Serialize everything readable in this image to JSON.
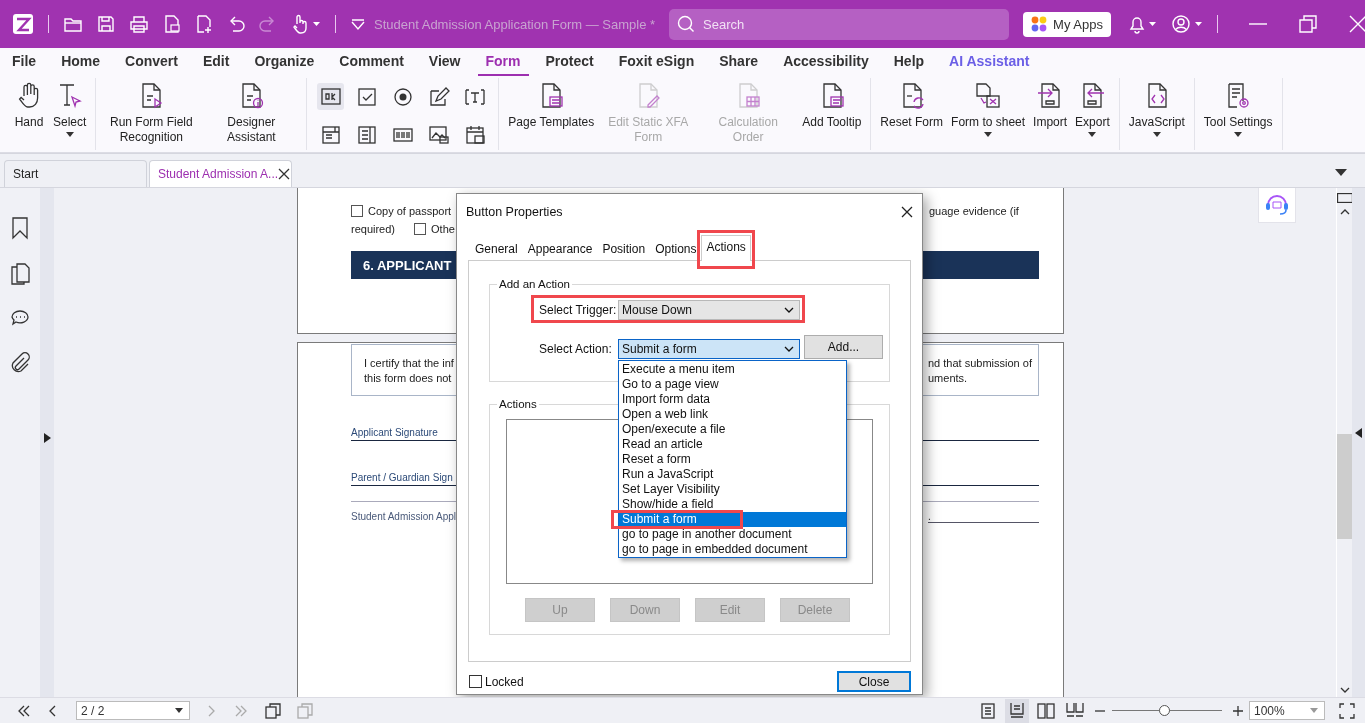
{
  "title_bar": {
    "title": "Student Admission Application Form — Sample *",
    "search": {
      "placeholder": "Search"
    },
    "my_apps": "My Apps"
  },
  "menu": [
    {
      "label": "File",
      "selected": false,
      "kind": "tab"
    },
    {
      "label": "Home",
      "selected": false,
      "kind": "tab"
    },
    {
      "label": "Convert",
      "selected": false,
      "kind": "tab"
    },
    {
      "label": "Edit",
      "selected": false,
      "kind": "tab"
    },
    {
      "label": "Organize",
      "selected": false,
      "kind": "tab"
    },
    {
      "label": "Comment",
      "selected": false,
      "kind": "tab"
    },
    {
      "label": "View",
      "selected": false,
      "kind": "tab"
    },
    {
      "label": "Form",
      "selected": true,
      "kind": "tab"
    },
    {
      "label": "Protect",
      "selected": false,
      "kind": "tab"
    },
    {
      "label": "Foxit eSign",
      "selected": false,
      "kind": "tab"
    },
    {
      "label": "Share",
      "selected": false,
      "kind": "tab"
    },
    {
      "label": "Accessibility",
      "selected": false,
      "kind": "tab"
    },
    {
      "label": "Help",
      "selected": false,
      "kind": "tab"
    },
    {
      "label": "AI Assistant",
      "selected": false,
      "kind": "assistant"
    }
  ],
  "ribbon": {
    "groups": [
      {
        "kind": "tools",
        "tools": [
          {
            "label": "Hand",
            "disabled": false,
            "dropdown": false
          },
          {
            "label": "Select",
            "disabled": false,
            "dropdown": true
          }
        ]
      },
      {
        "kind": "tools",
        "tools": [
          {
            "label": "Run Form Field Recognition",
            "disabled": false,
            "dropdown": false
          },
          {
            "label": "Designer Assistant",
            "disabled": false,
            "dropdown": false
          }
        ]
      },
      {
        "kind": "grid",
        "buttons": [
          {
            "selected": true
          },
          {
            "selected": false
          },
          {
            "selected": false
          },
          {
            "selected": false
          },
          {
            "selected": false
          },
          {
            "selected": false
          },
          {
            "selected": false
          },
          {
            "selected": false
          },
          {
            "selected": false
          },
          {
            "selected": false
          }
        ]
      },
      {
        "kind": "tools",
        "tools": [
          {
            "label": "Page Templates",
            "disabled": false,
            "dropdown": false
          },
          {
            "label": "Edit Static XFA Form",
            "disabled": true,
            "dropdown": false
          },
          {
            "label": "Calculation Order",
            "disabled": true,
            "dropdown": false
          },
          {
            "label": "Add Tooltip",
            "disabled": false,
            "dropdown": false
          }
        ]
      },
      {
        "kind": "tools",
        "tools": [
          {
            "label": "Reset Form",
            "disabled": false,
            "dropdown": false
          },
          {
            "label": "Form to sheet",
            "disabled": false,
            "dropdown": true
          },
          {
            "label": "Import",
            "disabled": false,
            "dropdown": false
          },
          {
            "label": "Export",
            "disabled": false,
            "dropdown": true
          }
        ]
      },
      {
        "kind": "tools",
        "tools": [
          {
            "label": "JavaScript",
            "disabled": false,
            "dropdown": true
          }
        ]
      },
      {
        "kind": "tools",
        "tools": [
          {
            "label": "Tool Settings",
            "disabled": false,
            "dropdown": true
          }
        ]
      }
    ]
  },
  "doc_tabs": [
    {
      "label": "Start",
      "selected": false,
      "closable": false
    },
    {
      "label": "Student Admission A...",
      "selected": true,
      "closable": true
    }
  ],
  "page_1": {
    "checkbox_line": {
      "checked": false,
      "left": "Copy of passport",
      "right": "guage evidence (if"
    },
    "second_line": {
      "before": "required)",
      "checked": false,
      "after": "Othe"
    },
    "section_banner": "6. APPLICANT"
  },
  "page_2": {
    "statement": {
      "left_lines": [
        "I certify that the inf",
        "this form does not"
      ],
      "right_lines": [
        "nd that submission of",
        "uments."
      ]
    },
    "signature_lines": [
      "Applicant Signature",
      "Parent / Guardian Sign"
    ],
    "footer": {
      "left": "Student Admission Appl",
      "right": "."
    }
  },
  "dialog": {
    "title": "Button Properties",
    "tabs": [
      {
        "label": "General",
        "selected": false,
        "highlighted": false
      },
      {
        "label": "Appearance",
        "selected": false,
        "highlighted": false
      },
      {
        "label": "Position",
        "selected": false,
        "highlighted": false
      },
      {
        "label": "Options",
        "selected": false,
        "highlighted": false
      },
      {
        "label": "Actions",
        "selected": true,
        "highlighted": true
      }
    ],
    "add_group": {
      "title": "Add an Action",
      "trigger": {
        "label": "Select Trigger:",
        "value": "Mouse Down",
        "highlighted": true
      },
      "action": {
        "label": "Select Action:",
        "value": "Submit a form",
        "expanded": true,
        "options": [
          {
            "label": "Execute a menu item",
            "selected": false,
            "highlighted": false
          },
          {
            "label": "Go to a page view",
            "selected": false,
            "highlighted": false
          },
          {
            "label": "Import form data",
            "selected": false,
            "highlighted": false
          },
          {
            "label": "Open a web link",
            "selected": false,
            "highlighted": false
          },
          {
            "label": "Open/execute a file",
            "selected": false,
            "highlighted": false
          },
          {
            "label": "Read an article",
            "selected": false,
            "highlighted": false
          },
          {
            "label": "Reset a form",
            "selected": false,
            "highlighted": false
          },
          {
            "label": "Run a JavaScript",
            "selected": false,
            "highlighted": false
          },
          {
            "label": "Set Layer Visibility",
            "selected": false,
            "highlighted": false
          },
          {
            "label": "Show/hide a field",
            "selected": false,
            "highlighted": false
          },
          {
            "label": "Submit a form",
            "selected": true,
            "highlighted": true
          },
          {
            "label": "go to page in another document",
            "selected": false,
            "highlighted": false
          },
          {
            "label": "go to page in embedded document",
            "selected": false,
            "highlighted": false
          }
        ]
      },
      "add_button": "Add..."
    },
    "actions_group": {
      "title": "Actions",
      "buttons": [
        {
          "label": "Up",
          "disabled": true
        },
        {
          "label": "Down",
          "disabled": true
        },
        {
          "label": "Edit",
          "disabled": true
        },
        {
          "label": "Delete",
          "disabled": true
        }
      ]
    },
    "locked": {
      "label": "Locked",
      "checked": false
    },
    "close_button": "Close"
  },
  "status_bar": {
    "nav_buttons": [
      {
        "disabled": false
      },
      {
        "disabled": false
      },
      {
        "disabled": true
      },
      {
        "disabled": true
      }
    ],
    "page_field": "2 / 2",
    "view_modes": [
      {
        "selected": false
      },
      {
        "selected": true
      },
      {
        "selected": false
      },
      {
        "selected": false
      }
    ],
    "zoom": {
      "level": 0.48
    },
    "zoom_field": "100%"
  }
}
